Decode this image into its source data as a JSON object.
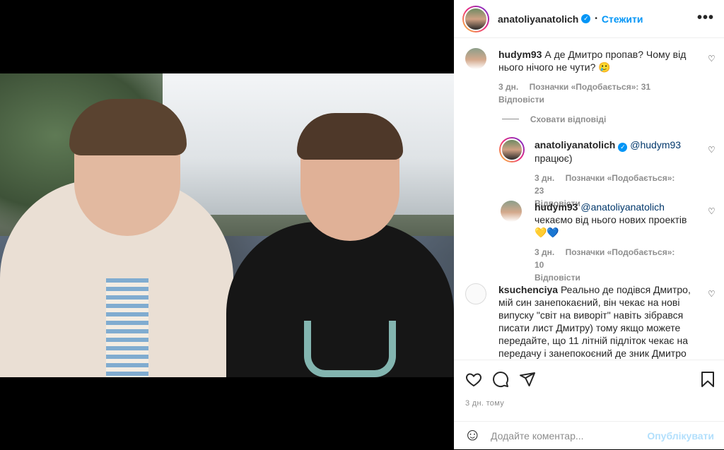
{
  "post": {
    "author": "anatoliyanatolich",
    "dot": "•",
    "follow_label": "Стежити",
    "more": "•••"
  },
  "comments": [
    {
      "user": "hudym93",
      "text": "А де Дмитро пропав? Чому від нього нічого не чути? 🥲",
      "time": "3 дн.",
      "likes": "Позначки «Подобається»: 31",
      "reply": "Відповісти"
    }
  ],
  "hide_replies": "Сховати відповіді",
  "replies": [
    {
      "user": "anatoliyanatolich",
      "mention": "@hudym93",
      "text": "працює)",
      "time": "3 дн.",
      "likes": "Позначки «Подобається»: 23",
      "reply": "Відповісти"
    },
    {
      "user": "hudym93",
      "mention": "@anatoliyanatolich",
      "text": "чекаємо від нього нових проектів 💛💙",
      "time": "3 дн.",
      "likes": "Позначки «Подобається»: 10",
      "reply": "Відповісти"
    }
  ],
  "comment3": {
    "user": "ksuchenciya",
    "text": "Реально де подівся Дмитро, мій син занепокаєний, він чекає на нові випуску \"світ на виворіт\" навіть зібрався писати лист Дмитру) тому якщо можете передайте, що 11 літній підліток чекає на передачу і занепокоєний де зник Дмитро"
  },
  "timeline": "3 дн. тому",
  "add_comment": {
    "placeholder": "Додайте коментар...",
    "publish": "Опублікувати"
  },
  "icons": {
    "heart": "♡",
    "emoji": "☺"
  },
  "colors": {
    "accent": "#0095f6",
    "verified": "#0095f6",
    "publish_disabled": "#b2dffc"
  }
}
